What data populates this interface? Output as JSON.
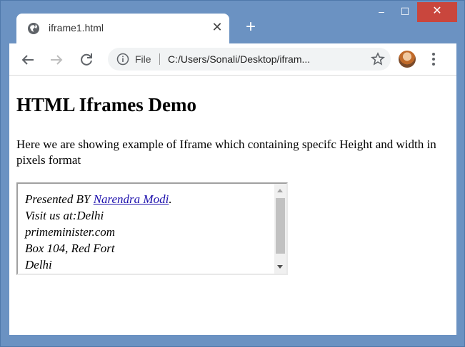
{
  "browser": {
    "tab_title": "iframe1.html",
    "tab_close": "✕",
    "new_tab": "+",
    "window_controls": {
      "minimize": "–",
      "maximize": "☐",
      "close": "✕"
    },
    "omnibox": {
      "scheme_label": "File",
      "url": "C:/Users/Sonali/Desktop/ifram..."
    },
    "accent_color": "#6b92c2",
    "close_color": "#c9463d"
  },
  "page": {
    "title": "HTML Iframes Demo",
    "description": "Here we are showing example of Iframe which containing specifc Height and width in pixels format",
    "iframe": {
      "line1_prefix": "Presented BY ",
      "line1_link": "Narendra Modi",
      "line1_suffix": ".",
      "line2": "Visit us at:Delhi",
      "line3": "primeminister.com",
      "line4": "Box 104, Red Fort",
      "line5": "Delhi"
    }
  }
}
